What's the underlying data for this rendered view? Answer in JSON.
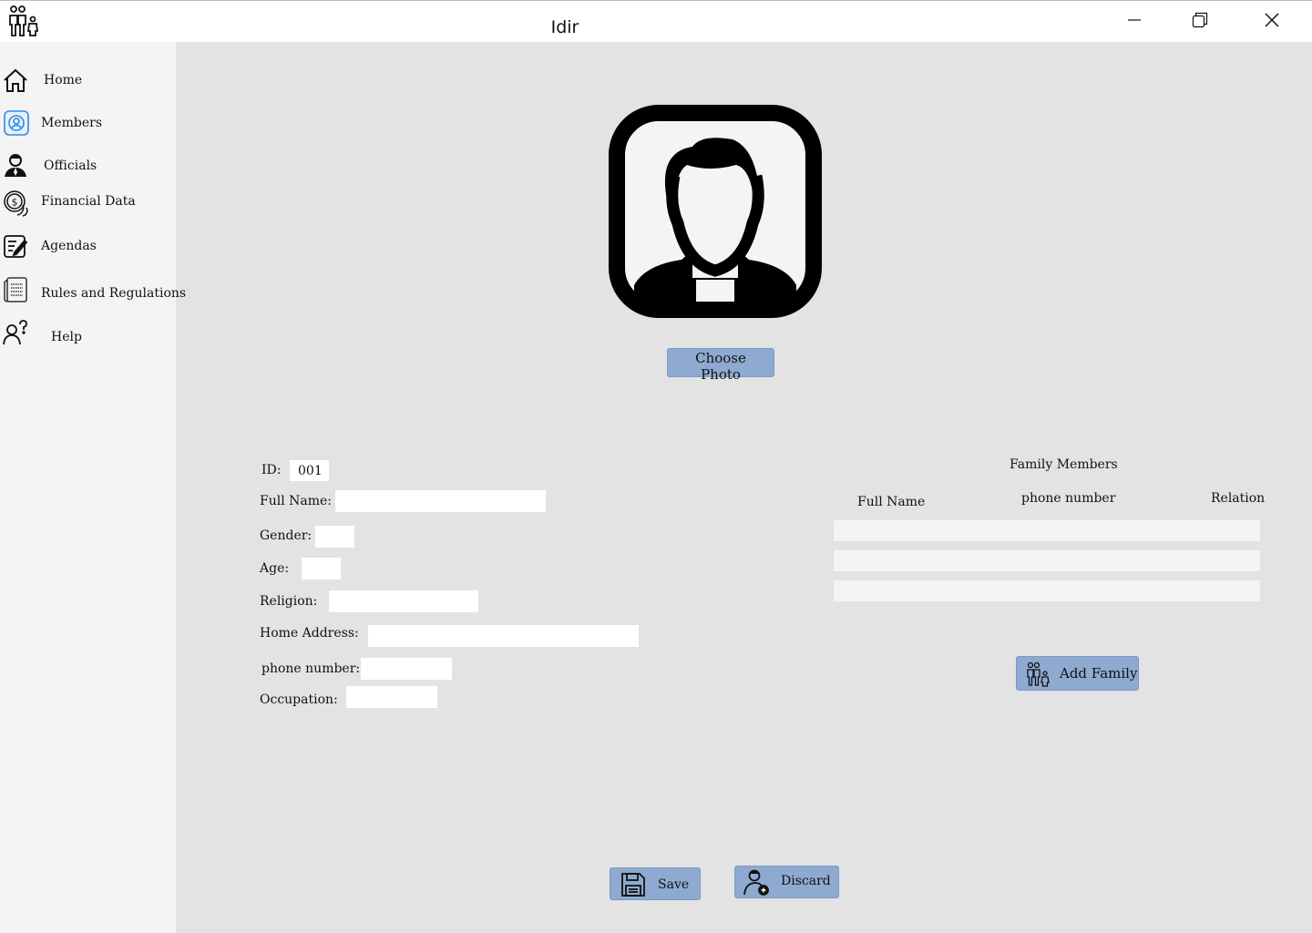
{
  "window": {
    "title": "Idir",
    "app_icon": "family-icon",
    "controls": [
      "minimize-icon",
      "restore-icon",
      "close-icon"
    ]
  },
  "sidebar": {
    "items": [
      {
        "label": "Home",
        "icon": "home-icon"
      },
      {
        "label": "Members",
        "icon": "members-icon"
      },
      {
        "label": "Officials",
        "icon": "official-icon"
      },
      {
        "label": "Financial Data",
        "icon": "coins-icon"
      },
      {
        "label": "Agendas",
        "icon": "notepad-icon"
      },
      {
        "label": "Rules and Regulations",
        "icon": "document-icon"
      },
      {
        "label": "Help",
        "icon": "help-icon"
      }
    ]
  },
  "photo": {
    "icon": "user-avatar-icon",
    "choose_label": "Choose Photo"
  },
  "form": {
    "id_label": "ID:",
    "id_value": "001",
    "full_name_label": "Full Name:",
    "full_name_value": "",
    "gender_label": "Gender:",
    "gender_value": "",
    "age_label": "Age:",
    "age_value": "",
    "religion_label": "Religion:",
    "religion_value": "",
    "address_label": "Home Address:",
    "address_value": "",
    "phone_label": "phone number:",
    "phone_value": "",
    "occupation_label": "Occupation:",
    "occupation_value": ""
  },
  "family": {
    "title": "Family Members",
    "columns": [
      "Full Name",
      "phone number",
      "Relation"
    ],
    "rows": [
      [
        "",
        "",
        ""
      ],
      [
        "",
        "",
        ""
      ],
      [
        "",
        "",
        ""
      ]
    ],
    "add_label": "Add Family",
    "add_icon": "family-icon"
  },
  "actions": {
    "save_label": "Save",
    "save_icon": "floppy-disk-icon",
    "discard_label": "Discard",
    "discard_icon": "user-discard-icon"
  },
  "colors": {
    "button": "#8eaad0",
    "background": "#e3e3e3",
    "sidebar": "#f4f4f4",
    "titlebar": "#ffffff"
  }
}
